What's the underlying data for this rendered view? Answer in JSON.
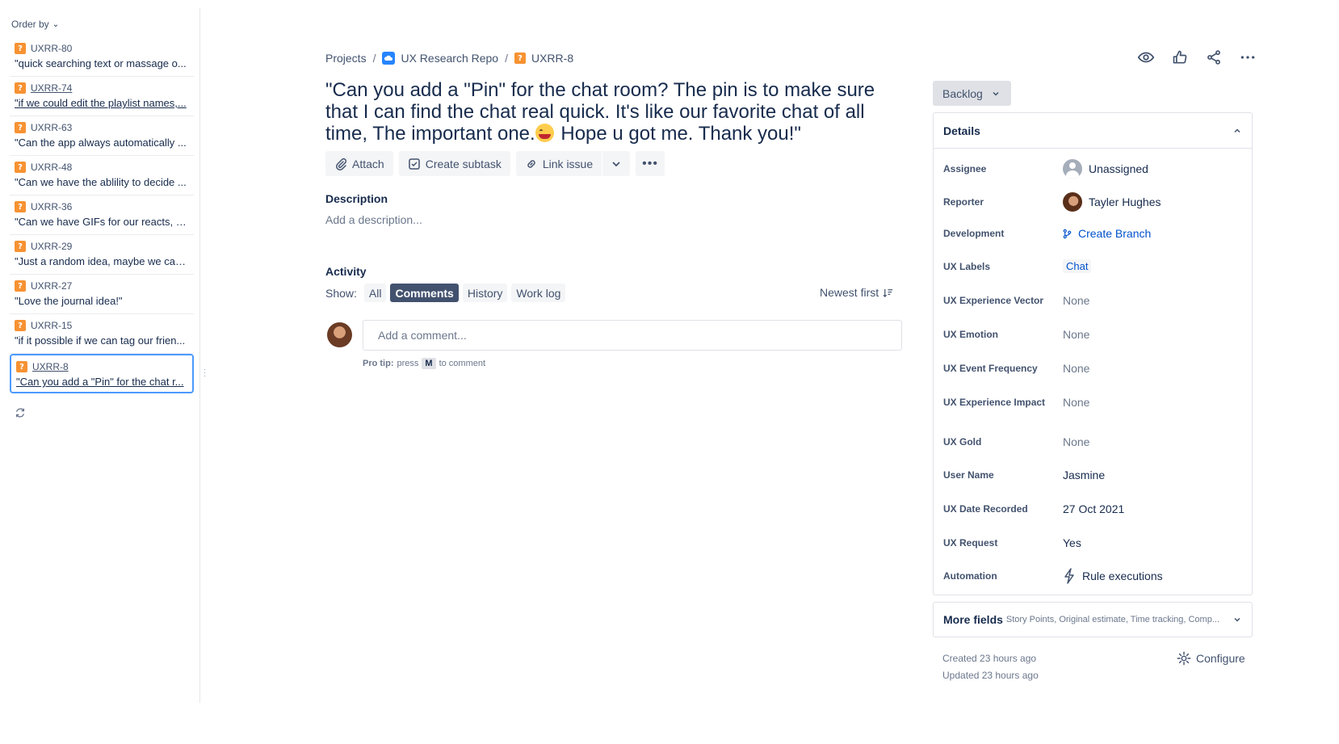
{
  "sidebar": {
    "order_by": "Order by",
    "issues": [
      {
        "key": "UXRR-80",
        "summary": "\"quick searching text or massage o..."
      },
      {
        "key": "UXRR-74",
        "summary": "\"if we could edit the playlist names,..."
      },
      {
        "key": "UXRR-63",
        "summary": "\"Can the app always automatically ..."
      },
      {
        "key": "UXRR-48",
        "summary": "\"Can we have the ablility to decide ..."
      },
      {
        "key": "UXRR-36",
        "summary": "\"Can we have GIFs for our reacts, o..."
      },
      {
        "key": "UXRR-29",
        "summary": "\"Just a random idea, maybe we can..."
      },
      {
        "key": "UXRR-27",
        "summary": "\"Love the journal idea!\""
      },
      {
        "key": "UXRR-15",
        "summary": "\"if it possible if we can tag our frien..."
      },
      {
        "key": "UXRR-8",
        "summary": "\"Can you add a \"Pin\" for the chat r..."
      }
    ]
  },
  "breadcrumb": {
    "projects": "Projects",
    "separator": "/",
    "project": "UX Research Repo",
    "issue": "UXRR-8"
  },
  "issue": {
    "title_part1": "\"Can you add a \"Pin\" for the chat room? The pin is to make sure that I can find the chat real quick. It's like our favorite chat of all time, The important one.",
    "title_part2": " Hope u got me. Thank you!\""
  },
  "toolbar": {
    "attach": "Attach",
    "create_subtask": "Create subtask",
    "link_issue": "Link issue",
    "more": "•••"
  },
  "description": {
    "label": "Description",
    "placeholder": "Add a description..."
  },
  "activity": {
    "label": "Activity",
    "show": "Show:",
    "filters": [
      "All",
      "Comments",
      "History",
      "Work log"
    ],
    "sort": "Newest first",
    "comment_placeholder": "Add a comment...",
    "protip_bold": "Pro tip:",
    "protip_press": "press",
    "protip_key": "M",
    "protip_rest": "to comment"
  },
  "status": {
    "label": "Backlog"
  },
  "details": {
    "header": "Details",
    "fields": [
      {
        "label": "Assignee",
        "value": "Unassigned"
      },
      {
        "label": "Reporter",
        "value": "Tayler Hughes"
      },
      {
        "label": "Development",
        "value": "Create Branch"
      },
      {
        "label": "UX Labels",
        "value": "Chat"
      },
      {
        "label": "UX Experience Vector",
        "value": "None"
      },
      {
        "label": "UX Emotion",
        "value": "None"
      },
      {
        "label": "UX Event Frequency",
        "value": "None"
      },
      {
        "label": "UX Experience Impact",
        "value": "None"
      },
      {
        "label": "UX Gold",
        "value": "None"
      },
      {
        "label": "User Name",
        "value": "Jasmine"
      },
      {
        "label": "UX Date Recorded",
        "value": "27 Oct 2021"
      },
      {
        "label": "UX Request",
        "value": "Yes"
      },
      {
        "label": "Automation",
        "value": "Rule executions"
      }
    ]
  },
  "more_fields": {
    "title": "More fields",
    "subtitle": "Story Points, Original estimate, Time tracking, Comp..."
  },
  "meta": {
    "created": "Created 23 hours ago",
    "updated": "Updated 23 hours ago",
    "configure": "Configure"
  },
  "colors": {
    "accent": "#0052cc",
    "issue_icon": "#f79232",
    "selected_border": "#4c9aff"
  }
}
